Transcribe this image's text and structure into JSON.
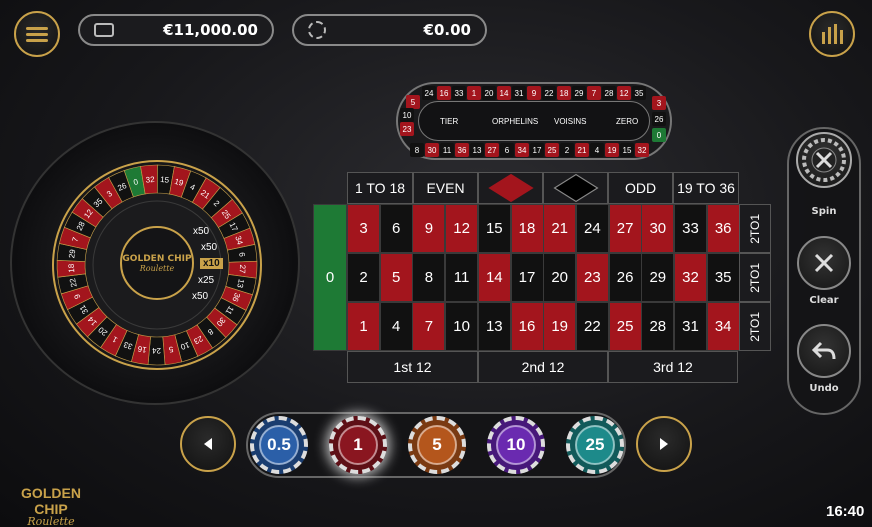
{
  "header": {
    "balance": "€11,000.00",
    "bet_total": "€0.00"
  },
  "racetrack": {
    "top_row": [
      "5",
      "24",
      "16",
      "33",
      "1",
      "20",
      "14",
      "31",
      "9",
      "22",
      "18",
      "29",
      "7",
      "28",
      "12",
      "35"
    ],
    "bottom_row": [
      "8",
      "30",
      "11",
      "36",
      "13",
      "27",
      "6",
      "34",
      "17",
      "25",
      "2",
      "21",
      "4",
      "19",
      "15",
      "32"
    ],
    "left_end": [
      "10",
      "23"
    ],
    "right_end": [
      "3",
      "26",
      "0"
    ],
    "sections": [
      "TIER",
      "ORPHELINS",
      "VOISINS",
      "ZERO"
    ]
  },
  "table": {
    "zero": "0",
    "rows": [
      [
        {
          "n": "3",
          "c": "red"
        },
        {
          "n": "6",
          "c": "blk"
        },
        {
          "n": "9",
          "c": "red"
        },
        {
          "n": "12",
          "c": "red"
        },
        {
          "n": "15",
          "c": "blk"
        },
        {
          "n": "18",
          "c": "red"
        },
        {
          "n": "21",
          "c": "red"
        },
        {
          "n": "24",
          "c": "blk"
        },
        {
          "n": "27",
          "c": "red"
        },
        {
          "n": "30",
          "c": "red"
        },
        {
          "n": "33",
          "c": "blk"
        },
        {
          "n": "36",
          "c": "red"
        }
      ],
      [
        {
          "n": "2",
          "c": "blk"
        },
        {
          "n": "5",
          "c": "red"
        },
        {
          "n": "8",
          "c": "blk"
        },
        {
          "n": "11",
          "c": "blk"
        },
        {
          "n": "14",
          "c": "red"
        },
        {
          "n": "17",
          "c": "blk"
        },
        {
          "n": "20",
          "c": "blk"
        },
        {
          "n": "23",
          "c": "red"
        },
        {
          "n": "26",
          "c": "blk"
        },
        {
          "n": "29",
          "c": "blk"
        },
        {
          "n": "32",
          "c": "red"
        },
        {
          "n": "35",
          "c": "blk"
        }
      ],
      [
        {
          "n": "1",
          "c": "red"
        },
        {
          "n": "4",
          "c": "blk"
        },
        {
          "n": "7",
          "c": "red"
        },
        {
          "n": "10",
          "c": "blk"
        },
        {
          "n": "13",
          "c": "blk"
        },
        {
          "n": "16",
          "c": "red"
        },
        {
          "n": "19",
          "c": "red"
        },
        {
          "n": "22",
          "c": "blk"
        },
        {
          "n": "25",
          "c": "red"
        },
        {
          "n": "28",
          "c": "blk"
        },
        {
          "n": "31",
          "c": "blk"
        },
        {
          "n": "34",
          "c": "red"
        }
      ]
    ],
    "top_bets": [
      "1 TO 18",
      "EVEN",
      "",
      "",
      "ODD",
      "19 TO 36"
    ],
    "dozens": [
      "1st 12",
      "2nd 12",
      "3rd 12"
    ],
    "columns": [
      "2TO1",
      "2TO1",
      "2TO1"
    ]
  },
  "wheel": {
    "logo_line1": "GOLDEN CHIP",
    "logo_line2": "Roulette",
    "multipliers": [
      "x50",
      "x50",
      "x10",
      "x25",
      "x50"
    ],
    "numbers": [
      "0",
      "32",
      "15",
      "19",
      "4",
      "21",
      "2",
      "25",
      "17",
      "34",
      "6",
      "27",
      "13",
      "36",
      "11",
      "30",
      "8",
      "23",
      "10",
      "5",
      "24",
      "16",
      "33",
      "1",
      "20",
      "14",
      "31",
      "9",
      "22",
      "18",
      "29",
      "7",
      "28",
      "12",
      "35",
      "3",
      "26"
    ]
  },
  "controls": {
    "spin": "Spin",
    "clear": "Clear",
    "undo": "Undo"
  },
  "chips": [
    "0.5",
    "1",
    "5",
    "10",
    "25"
  ],
  "brand": {
    "line1": "GOLDEN CHIP",
    "line2": "Roulette"
  },
  "clock": "16:40",
  "colors": {
    "gold": "#c9a24a",
    "red": "#a3151d",
    "green": "#1e7a35"
  }
}
